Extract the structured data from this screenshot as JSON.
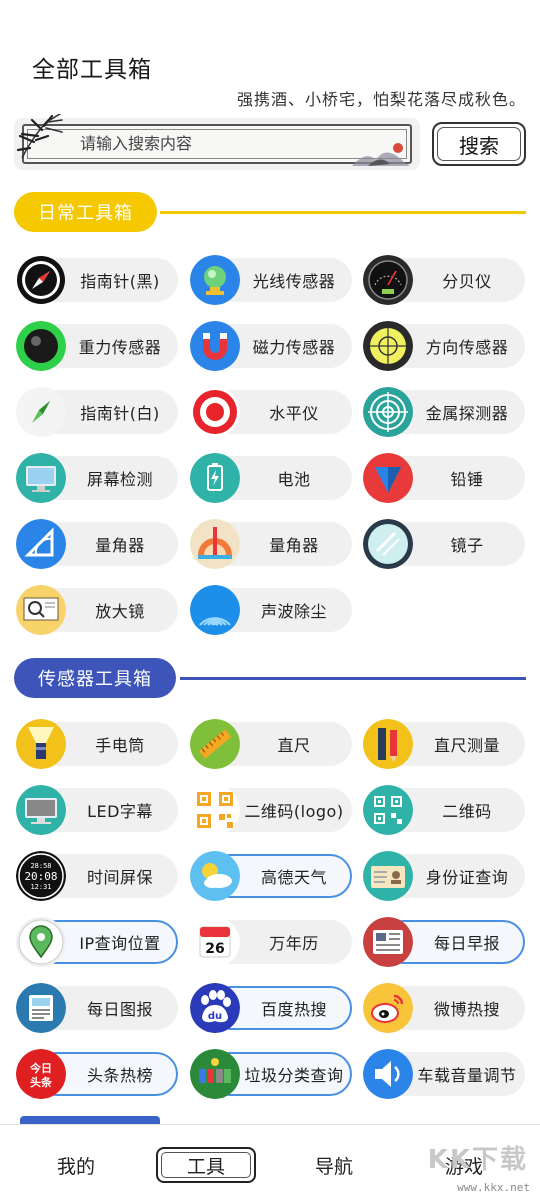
{
  "header": {
    "title": "全部工具箱",
    "slogan": "强携酒、小桥宅，怕梨花落尽成秋色。"
  },
  "search": {
    "placeholder": "请输入搜索内容",
    "button_label": "搜索"
  },
  "sections": {
    "daily": {
      "title": "日常工具箱",
      "color": "#f5c800",
      "tools": [
        {
          "label": "指南针(黑)",
          "icon": "compass-black-icon"
        },
        {
          "label": "光线传感器",
          "icon": "light-sensor-icon"
        },
        {
          "label": "分贝仪",
          "icon": "decibel-meter-icon"
        },
        {
          "label": "重力传感器",
          "icon": "gravity-sensor-icon"
        },
        {
          "label": "磁力传感器",
          "icon": "magnet-icon"
        },
        {
          "label": "方向传感器",
          "icon": "direction-sensor-icon"
        },
        {
          "label": "指南针(白)",
          "icon": "compass-white-icon"
        },
        {
          "label": "水平仪",
          "icon": "level-icon"
        },
        {
          "label": "金属探测器",
          "icon": "metal-detector-icon"
        },
        {
          "label": "屏幕检测",
          "icon": "screen-test-icon"
        },
        {
          "label": "电池",
          "icon": "battery-icon"
        },
        {
          "label": "铅锤",
          "icon": "plumb-bob-icon"
        },
        {
          "label": "量角器",
          "icon": "protractor-blue-icon"
        },
        {
          "label": "量角器",
          "icon": "protractor-teal-icon"
        },
        {
          "label": "镜子",
          "icon": "mirror-icon"
        },
        {
          "label": "放大镜",
          "icon": "magnifier-icon"
        },
        {
          "label": "声波除尘",
          "icon": "sonic-dust-icon"
        }
      ]
    },
    "sensor": {
      "title": "传感器工具箱",
      "color": "#3d55b8",
      "tools": [
        {
          "label": "手电筒",
          "icon": "flashlight-icon"
        },
        {
          "label": "直尺",
          "icon": "ruler-icon"
        },
        {
          "label": "直尺测量",
          "icon": "ruler-measure-icon"
        },
        {
          "label": "LED字幕",
          "icon": "led-monitor-icon"
        },
        {
          "label": "二维码(logo)",
          "icon": "qrcode-logo-icon"
        },
        {
          "label": "二维码",
          "icon": "qrcode-icon"
        },
        {
          "label": "时间屏保",
          "icon": "clock-screensaver-icon"
        },
        {
          "label": "高德天气",
          "icon": "weather-icon"
        },
        {
          "label": "身份证查询",
          "icon": "id-card-icon"
        },
        {
          "label": "IP查询位置",
          "icon": "location-pin-icon"
        },
        {
          "label": "万年历",
          "icon": "calendar-icon"
        },
        {
          "label": "每日早报",
          "icon": "newspaper-icon"
        },
        {
          "label": "每日图报",
          "icon": "picture-news-icon"
        },
        {
          "label": "百度热搜",
          "icon": "baidu-icon"
        },
        {
          "label": "微博热搜",
          "icon": "weibo-icon"
        },
        {
          "label": "头条热榜",
          "icon": "toutiao-icon"
        },
        {
          "label": "垃圾分类查询",
          "icon": "trash-sort-icon"
        },
        {
          "label": "车载音量调节",
          "icon": "speaker-icon"
        }
      ],
      "icon_text": {
        "clock_top": "28:58",
        "clock_mid": "20:08",
        "clock_bot": "12:31",
        "calendar_day": "26",
        "baidu": "du",
        "toutiao": "今日头条"
      }
    }
  },
  "bottom_nav": {
    "items": [
      "我的",
      "工具",
      "导航",
      "游戏"
    ],
    "active": "工具"
  },
  "watermark": {
    "brand": "KK下载",
    "url": "www.kkx.net"
  }
}
